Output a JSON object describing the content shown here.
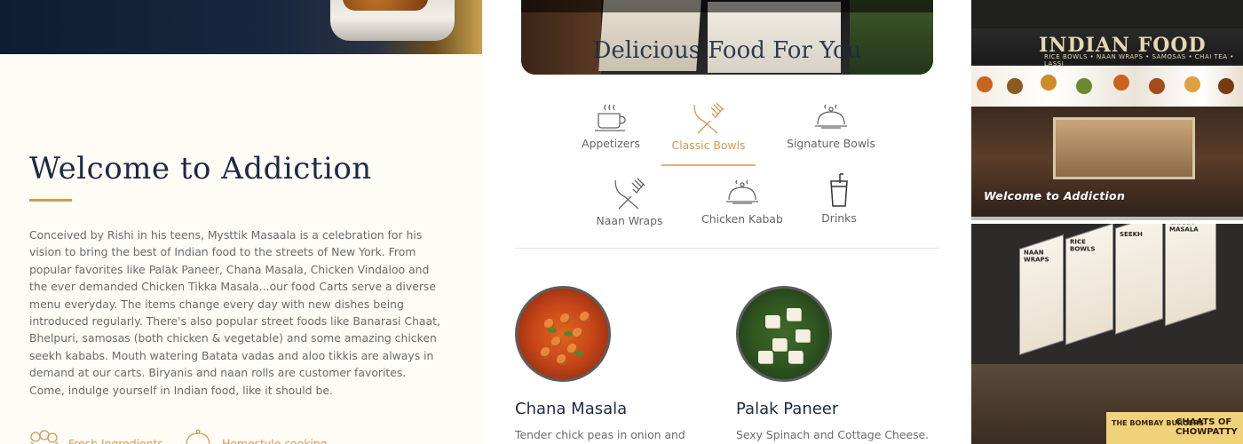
{
  "left": {
    "title": "Welcome to Addiction",
    "intro": "Conceived by Rishi in his teens, Mysttik Masaala is a celebration for his vision to bring the best of Indian food to the streets of New York. From popular favorites like Palak Paneer, Chana Masala, Chicken Vindaloo and the ever demanded Chicken Tikka Masala...our food Carts serve a diverse menu everyday. The items change every day with new dishes being introduced regularly. There's also popular street foods like Banarasi Chaat, Bhelpuri, samosas (both chicken & vegetable) and some amazing chicken seekh kababs. Mouth watering Batata vadas and aloo tikkis are always in demand at our carts. Biryanis and naan rolls are customer favorites.",
    "invite": "Come, indulge yourself in Indian food, like it should be.",
    "features": [
      {
        "label": "Fresh Ingredients",
        "icon": "ingredients-icon"
      },
      {
        "label": "Homestyle cooking",
        "icon": "cloche-icon"
      }
    ],
    "accent_color": "#d59a4f"
  },
  "middle": {
    "photo_title": "Delicious Food For You",
    "categories": [
      {
        "label": "Appetizers",
        "icon": "cup-icon",
        "active": false
      },
      {
        "label": "Classic Bowls",
        "icon": "cutlery-icon",
        "active": true
      },
      {
        "label": "Signature Bowls",
        "icon": "cloche-icon",
        "active": false
      },
      {
        "label": "Naan Wraps",
        "icon": "cutlery-icon",
        "active": false
      },
      {
        "label": "Chicken Kabab",
        "icon": "cloche-icon",
        "active": false
      },
      {
        "label": "Drinks",
        "icon": "drink-icon",
        "active": false
      }
    ],
    "dishes": [
      {
        "name": "Chana Masala",
        "desc": "Tender chick peas in onion and tomato"
      },
      {
        "name": "Palak Paneer",
        "desc": "Sexy Spinach and Cottage Cheese."
      }
    ],
    "title_color": "#1c2a44"
  },
  "right": {
    "top_photo": {
      "signboard": "INDIAN FOOD",
      "signboard_sub": "RICE BOWLS • NAAN WRAPS • SAMOSAS • CHAI TEA • LASSI",
      "watermark": "Welcome to Addiction"
    },
    "bottom_photo": {
      "panes": [
        "NAAN WRAPS",
        "RICE BOWLS",
        "SEEKH",
        "CHANA MASALA"
      ],
      "plaque_left": "THE BOMBAY BURGERS",
      "plaque_right": "CHAATS OF CHOWPATTY"
    }
  }
}
